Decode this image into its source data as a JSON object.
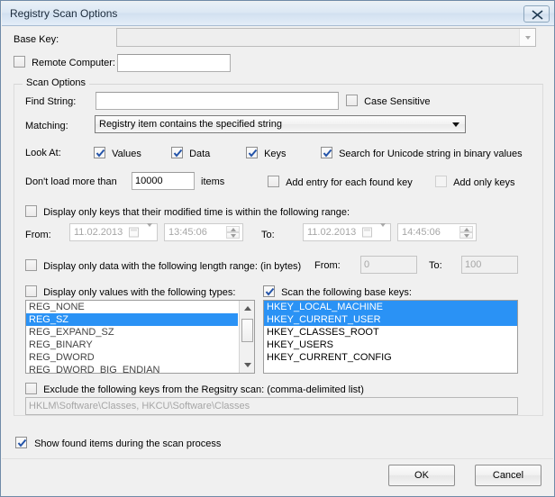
{
  "window": {
    "title": "Registry Scan Options",
    "close_icon": "close-icon"
  },
  "base_key": {
    "label": "Base Key:",
    "value": "",
    "placeholder": ""
  },
  "remote_computer": {
    "label": "Remote Computer:",
    "checked": false,
    "value": ""
  },
  "scan_options": {
    "group_title": "Scan Options",
    "find_string": {
      "label": "Find String:",
      "value": "",
      "placeholder": ""
    },
    "case_sensitive": {
      "label": "Case Sensitive",
      "checked": false
    },
    "matching": {
      "label": "Matching:",
      "value": "Registry item contains the specified string",
      "options": [
        "Registry item contains the specified string"
      ]
    },
    "look_at": {
      "label": "Look At:",
      "values": {
        "label": "Values",
        "checked": true
      },
      "data": {
        "label": "Data",
        "checked": true
      },
      "keys": {
        "label": "Keys",
        "checked": true
      },
      "unicode": {
        "label": "Search for Unicode string in binary values",
        "checked": true
      }
    },
    "load_limit": {
      "label_before": "Don't load more than",
      "value": "10000",
      "label_after": "items"
    },
    "add_entry_for_each_found_key": {
      "label": "Add entry for each found key",
      "checked": false
    },
    "add_only_keys": {
      "label": "Add only keys",
      "checked": false,
      "disabled": true
    },
    "modified_time_range": {
      "label": "Display only keys that their modified time is within the following range:",
      "checked": false,
      "from_label": "From:",
      "from_date": "11.02.2013",
      "from_time": "13:45:06",
      "to_label": "To:",
      "to_date": "11.02.2013",
      "to_time": "14:45:06"
    },
    "data_length_range": {
      "label": "Display only data with the following length range: (in bytes)",
      "checked": false,
      "from_label": "From:",
      "from_value": "0",
      "to_label": "To:",
      "to_value": "100"
    },
    "value_types": {
      "label": "Display only values with the following types:",
      "checked": false,
      "items": [
        {
          "text": "REG_NONE",
          "selected": false
        },
        {
          "text": "REG_SZ",
          "selected": true
        },
        {
          "text": "REG_EXPAND_SZ",
          "selected": false
        },
        {
          "text": "REG_BINARY",
          "selected": false
        },
        {
          "text": "REG_DWORD",
          "selected": false
        },
        {
          "text": "REG_DWORD_BIG_ENDIAN",
          "selected": false
        }
      ]
    },
    "base_keys": {
      "label": "Scan the following base keys:",
      "checked": true,
      "items": [
        {
          "text": "HKEY_LOCAL_MACHINE",
          "selected": true
        },
        {
          "text": "HKEY_CURRENT_USER",
          "selected": true
        },
        {
          "text": "HKEY_CLASSES_ROOT",
          "selected": false
        },
        {
          "text": "HKEY_USERS",
          "selected": false
        },
        {
          "text": "HKEY_CURRENT_CONFIG",
          "selected": false
        }
      ]
    },
    "exclude_keys": {
      "label": "Exclude the following keys from the Regsitry scan: (comma-delimited list)",
      "checked": false,
      "value": "HKLM\\Software\\Classes, HKCU\\Software\\Classes"
    }
  },
  "show_found_items": {
    "label": "Show found items during the scan process",
    "checked": true
  },
  "buttons": {
    "ok": "OK",
    "cancel": "Cancel"
  },
  "colors": {
    "selection_blue": "#2a92f5",
    "title_gradient_top": "#e9f0f7",
    "dialog_face": "#f0f0f0"
  }
}
